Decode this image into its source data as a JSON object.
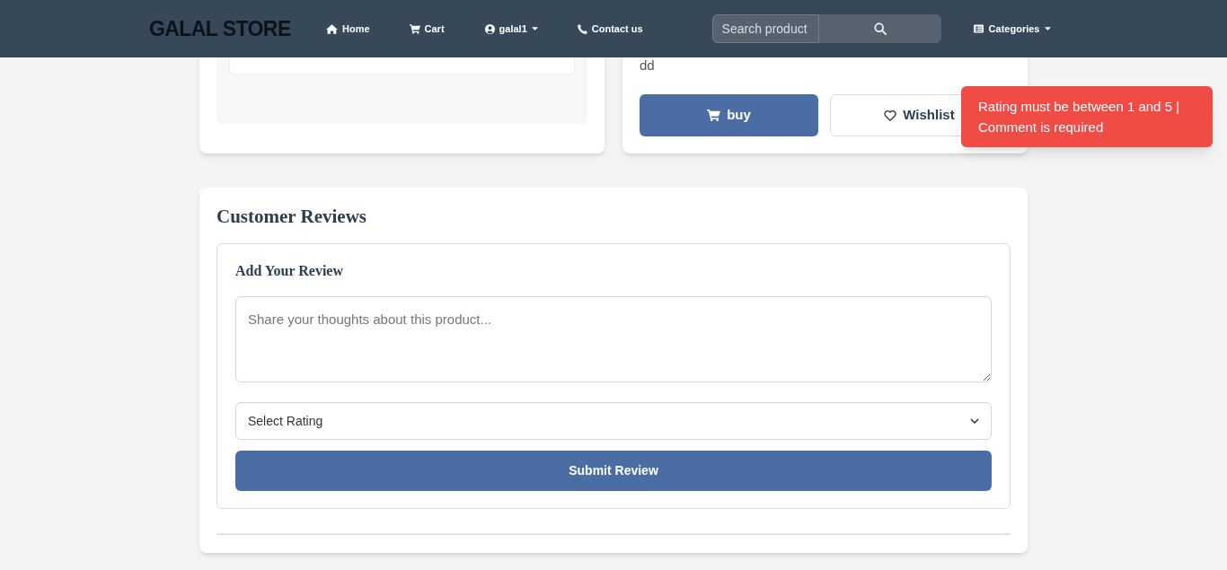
{
  "navbar": {
    "logo": "GALAL STORE",
    "links": [
      {
        "label": "Home",
        "kind": "home"
      },
      {
        "label": "Cart",
        "kind": "cart"
      },
      {
        "label": "galal1",
        "kind": "user",
        "dropdown": true
      },
      {
        "label": "Contact us",
        "kind": "phone"
      }
    ],
    "search": {
      "placeholder": "Search product"
    },
    "categories": {
      "label": "Categories",
      "dropdown": true
    }
  },
  "product": {
    "description": "dd",
    "buy_label": "buy",
    "wishlist_label": "Wishlist"
  },
  "toast": {
    "message": "Rating must be between 1 and 5 | Comment is required"
  },
  "reviews": {
    "title": "Customer Reviews",
    "form_title": "Add Your Review",
    "comment_placeholder": "Share your thoughts about this product...",
    "rating_select": "Select Rating",
    "submit_label": "Submit Review"
  }
}
